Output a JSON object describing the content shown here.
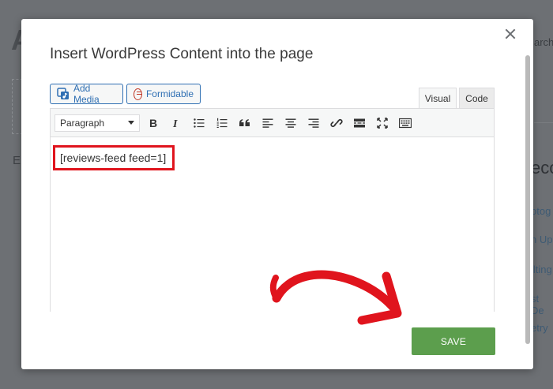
{
  "background": {
    "search_fragment": "arch",
    "heading_fragment": "E",
    "rec_fragment": "eco",
    "items": [
      "otog",
      "n Up",
      "ilting",
      "st De",
      "etry"
    ]
  },
  "modal": {
    "title": "Insert WordPress Content into the page",
    "add_media_label": "Add Media",
    "formidable_label": "Formidable",
    "tab_visual": "Visual",
    "tab_code": "Code",
    "format_value": "Paragraph",
    "content": "[reviews-feed feed=1]",
    "save_label": "SAVE"
  },
  "toolbar_icons": [
    "bold-icon",
    "italic-icon",
    "bullet-list-icon",
    "numbered-list-icon",
    "blockquote-icon",
    "align-left-icon",
    "align-center-icon",
    "align-right-icon",
    "link-icon",
    "read-more-icon",
    "fullscreen-icon",
    "toolbar-toggle-icon"
  ],
  "colors": {
    "accent": "#2f6fb3",
    "save": "#5c9e4d",
    "highlight": "#e0141d",
    "overlay": "#6d7074"
  }
}
